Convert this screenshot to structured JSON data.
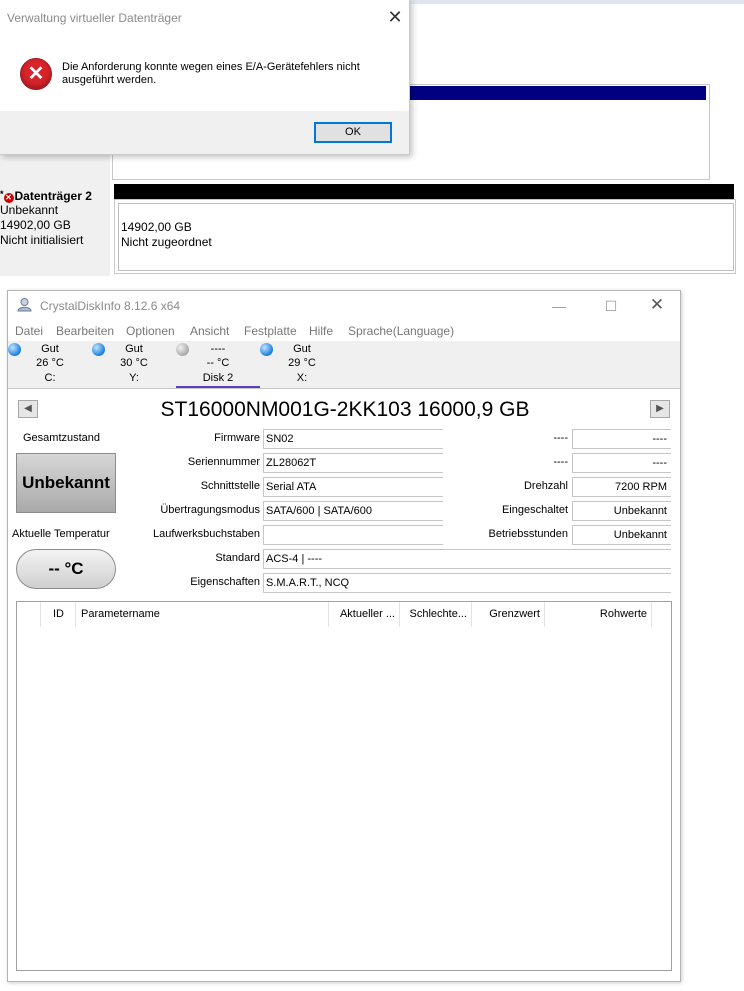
{
  "disk_management": {
    "disk2": {
      "title": "Datenträger 2",
      "status_icon": "error-circle-icon",
      "type": "Unbekannt",
      "size": "14902,00 GB",
      "state": "Nicht initialisiert"
    },
    "unallocated": {
      "size": "14902,00 GB",
      "label": "Nicht zugeordnet"
    },
    "colors": {
      "volume_bar": "#000080",
      "unallocated_bar": "#000000"
    }
  },
  "dialog": {
    "title": "Verwaltung virtueller Datenträger",
    "close_icon": "close-icon",
    "message": "Die Anforderung konnte wegen eines E/A-Gerätefehlers nicht ausgeführt werden.",
    "error_icon": "error-icon",
    "ok_label": "OK"
  },
  "crystaldiskinfo": {
    "title": "CrystalDiskInfo 8.12.6 x64",
    "menu": [
      "Datei",
      "Bearbeiten",
      "Optionen",
      "Ansicht",
      "Festplatte",
      "Hilfe",
      "Sprache(Language)"
    ],
    "disk_tabs": [
      {
        "status": "Gut",
        "temp": "26 °C",
        "drive": "C:",
        "color": "blue"
      },
      {
        "status": "Gut",
        "temp": "30 °C",
        "drive": "Y:",
        "color": "blue"
      },
      {
        "status": "----",
        "temp": "-- °C",
        "drive": "Disk 2",
        "color": "gray",
        "active": true
      },
      {
        "status": "Gut",
        "temp": "29 °C",
        "drive": "X:",
        "color": "blue"
      }
    ],
    "model": "ST16000NM001G-2KK103 16000,9 GB",
    "overall_label": "Gesamtzustand",
    "health": "Unbekannt",
    "temp_label": "Aktuelle Temperatur",
    "temp_value": "-- °C",
    "fields": {
      "firmware_label": "Firmware",
      "firmware": "SN02",
      "serial_label": "Seriennummer",
      "serial": "ZL28062T",
      "interface_label": "Schnittstelle",
      "interface": "Serial ATA",
      "transfer_label": "Übertragungsmodus",
      "transfer": "SATA/600 | SATA/600",
      "letters_label": "Laufwerksbuchstaben",
      "letters": "",
      "standard_label": "Standard",
      "standard": "ACS-4 | ----",
      "features_label": "Eigenschaften",
      "features": "S.M.A.R.T., NCQ"
    },
    "right_fields": {
      "r1_label": "----",
      "r1": "----",
      "r2_label": "----",
      "r2": "----",
      "rpm_label": "Drehzahl",
      "rpm": "7200 RPM",
      "poweron_count_label": "Eingeschaltet",
      "poweron_count": "Unbekannt",
      "hours_label": "Betriebsstunden",
      "hours": "Unbekannt"
    },
    "smart_columns": [
      "ID",
      "Parametername",
      "Aktueller ...",
      "Schlechte...",
      "Grenzwert",
      "Rohwerte"
    ]
  }
}
